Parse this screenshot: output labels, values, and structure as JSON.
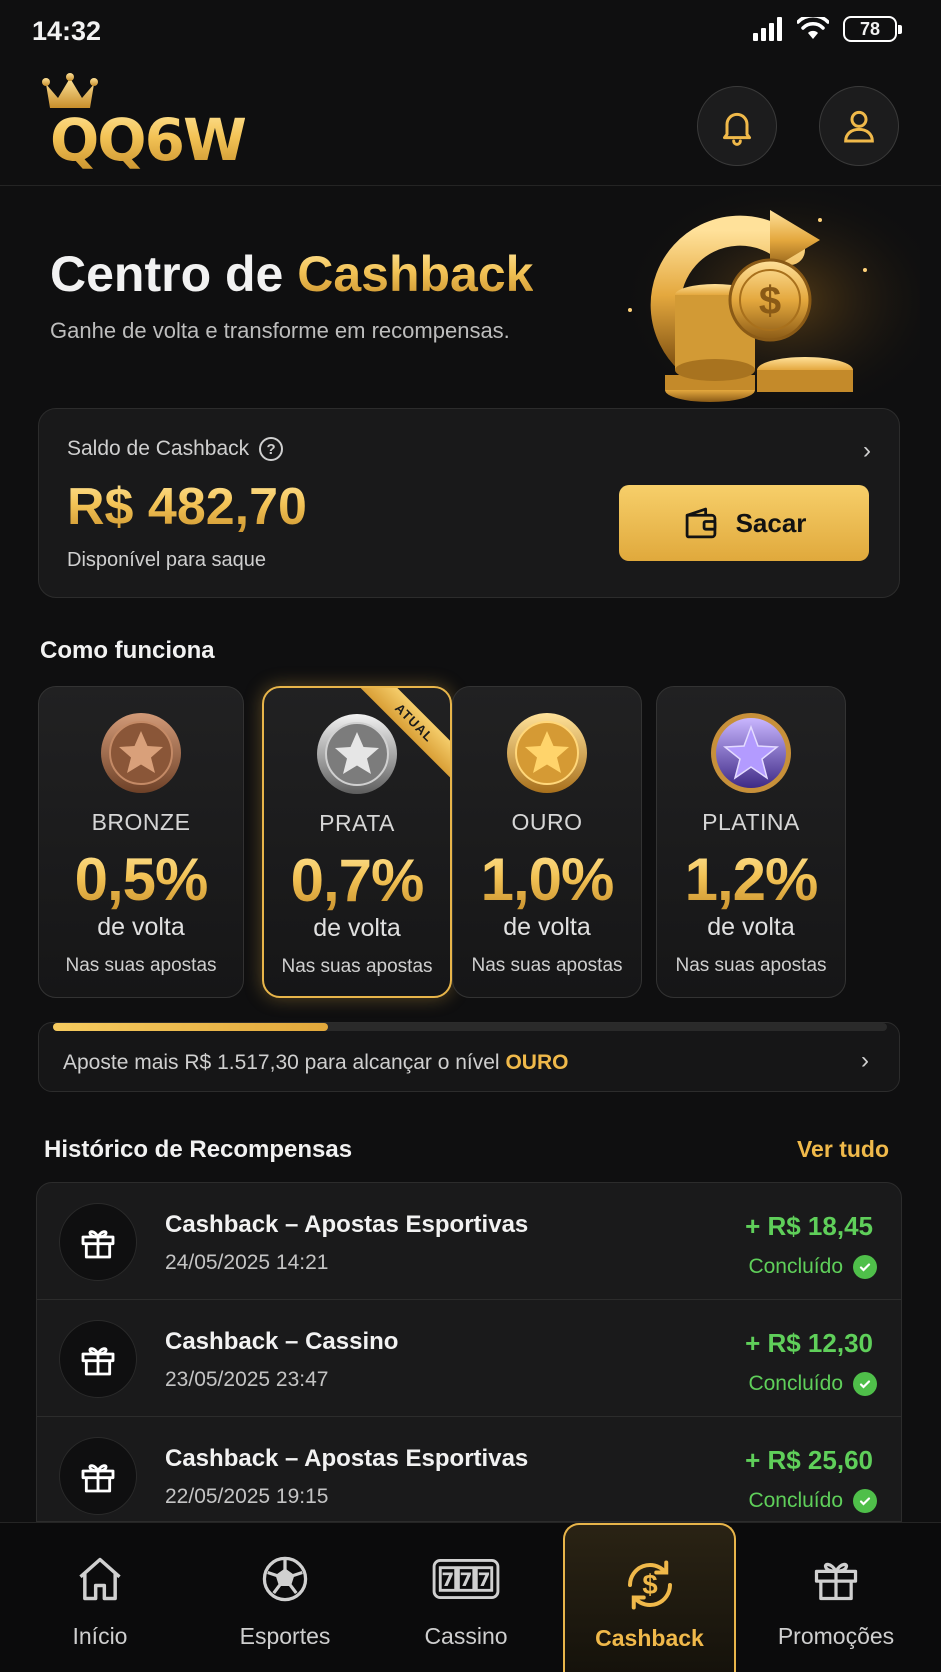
{
  "status": {
    "time": "14:32",
    "battery": "78"
  },
  "brand": {
    "logo_text": "QQ6W"
  },
  "hero": {
    "title_part1": "Centro de ",
    "title_part2": "Cashback",
    "subtitle": "Ganhe de volta e transforme em recompensas."
  },
  "balance": {
    "label": "Saldo de Cashback",
    "amount": "R$ 482,70",
    "available": "Disponível para saque",
    "withdraw_label": "Sacar"
  },
  "how_it_works": {
    "title": "Como funciona",
    "current_badge": "ATUAL",
    "tiers": [
      {
        "name": "BRONZE",
        "percent": "0,5%",
        "back": "de volta",
        "note": "Nas suas apostas",
        "color": "#b07a55"
      },
      {
        "name": "PRATA",
        "percent": "0,7%",
        "back": "de volta",
        "note": "Nas suas apostas",
        "color": "#a8a8a8",
        "current": true
      },
      {
        "name": "OURO",
        "percent": "1,0%",
        "back": "de volta",
        "note": "Nas suas apostas",
        "color": "#e6ad3a"
      },
      {
        "name": "PLATINA",
        "percent": "1,2%",
        "back": "de volta",
        "note": "Nas suas apostas",
        "color": "#7a5cd6"
      }
    ]
  },
  "progress": {
    "fraction": 0.33,
    "text_prefix": "Aposte mais R$ 1.517,30 para alcançar o nível ",
    "text_level": "OURO"
  },
  "history": {
    "title": "Histórico de Recompensas",
    "see_all": "Ver tudo",
    "rows": [
      {
        "title": "Cashback – Apostas Esportivas",
        "date": "24/05/2025 14:21",
        "amount": "+ R$ 18,45",
        "status": "Concluído"
      },
      {
        "title": "Cashback – Cassino",
        "date": "23/05/2025 23:47",
        "amount": "+ R$ 12,30",
        "status": "Concluído"
      },
      {
        "title": "Cashback – Apostas Esportivas",
        "date": "22/05/2025 19:15",
        "amount": "+ R$ 25,60",
        "status": "Concluído"
      }
    ]
  },
  "nav": {
    "items": [
      {
        "label": "Início",
        "icon": "home-icon"
      },
      {
        "label": "Esportes",
        "icon": "soccer-ball-icon"
      },
      {
        "label": "Cassino",
        "icon": "slot-machine-icon"
      },
      {
        "label": "Cashback",
        "icon": "cashback-icon",
        "active": true
      },
      {
        "label": "Promoções",
        "icon": "gift-icon"
      }
    ]
  },
  "colors": {
    "accent": "#f0b94a",
    "success": "#5fcf5a",
    "background": "#0f0f10"
  }
}
